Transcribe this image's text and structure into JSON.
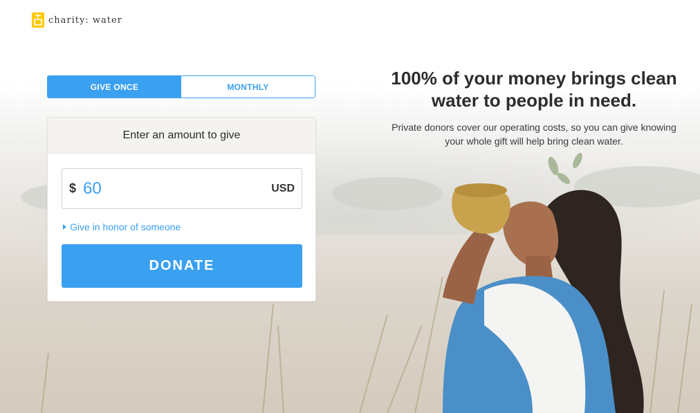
{
  "brand": {
    "name": "charity: water",
    "logo_icon": "jerrycan-icon",
    "accent": "#ffc907"
  },
  "colors": {
    "primary": "#3aa0f0",
    "text": "#2d2d2d"
  },
  "frequency": {
    "give_once_label": "GIVE ONCE",
    "monthly_label": "MONTHLY",
    "selected": "GIVE ONCE"
  },
  "donation_card": {
    "header": "Enter an amount to give",
    "currency_symbol": "$",
    "amount_value": "60",
    "currency_code": "USD",
    "honor_link": "Give in honor of someone",
    "donate_label": "DONATE"
  },
  "hero": {
    "headline": "100% of your money brings clean water to people in need.",
    "subtext": "Private donors cover our operating costs, so you can give knowing your whole gift will help bring clean water."
  }
}
